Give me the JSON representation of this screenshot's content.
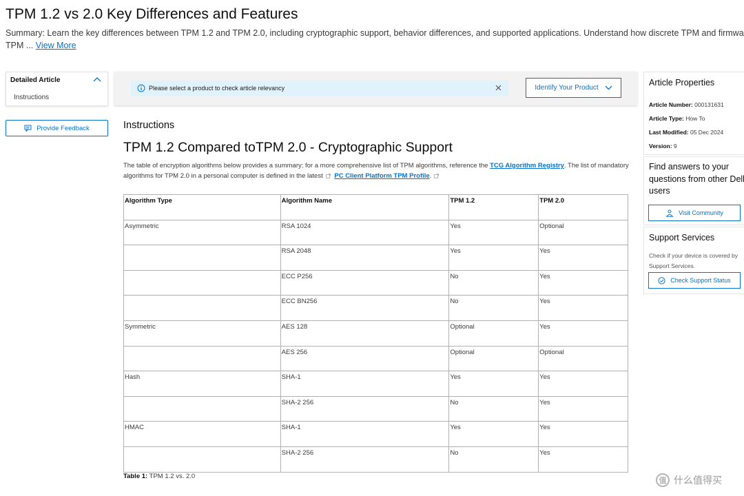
{
  "page": {
    "title": "TPM 1.2 vs 2.0 Key Differences and Features",
    "summary": "Summary: Learn the key differences between TPM 1.2 and TPM 2.0, including cryptographic support, behavior differences, and supported applications. Understand how discrete TPM and firmware TPM ...",
    "view_more": "View More"
  },
  "toc": {
    "heading": "Detailed Article",
    "items": [
      "Instructions"
    ]
  },
  "feedback": {
    "label": "Provide Feedback"
  },
  "product_bar": {
    "notice": "Please select a product to check article relevancy",
    "identify_label": "Identify Your Product"
  },
  "content": {
    "section_heading": "Instructions",
    "heading": "TPM 1.2 Compared toTPM 2.0 - Cryptographic Support",
    "intro_part1": "The table of encryption algorithms below provides a summary; for a more comprehensive list of TPM algorithms, reference the",
    "link1": "TCG Algorithm Registry",
    "intro_part2": ". The list of mandatory algorithms for TPM 2.0 in a personal computer is defined in the latest",
    "link2": "PC Client Platform TPM Profile",
    "intro_part3": ".",
    "table": {
      "headers": [
        "Algorithm Type",
        "Algorithm Name",
        "TPM 1.2",
        "TPM 2.0"
      ],
      "rows": [
        [
          "Asymmetric",
          "RSA 1024",
          "Yes",
          "Optional"
        ],
        [
          "",
          "RSA 2048",
          "Yes",
          "Yes"
        ],
        [
          "",
          "ECC P256",
          "No",
          "Yes"
        ],
        [
          "",
          "ECC BN256",
          "No",
          "Yes"
        ],
        [
          "Symmetric",
          "AES 128",
          "Optional",
          "Yes"
        ],
        [
          "",
          "AES 256",
          "Optional",
          "Optional"
        ],
        [
          "Hash",
          "SHA-1",
          "Yes",
          "Yes"
        ],
        [
          "",
          "SHA-2 256",
          "No",
          "Yes"
        ],
        [
          "HMAC",
          "SHA-1",
          "Yes",
          "Yes"
        ],
        [
          "",
          "SHA-2 256",
          "No",
          "Yes"
        ]
      ]
    },
    "caption_label": "Table 1:",
    "caption_text": "TPM 1.2 vs. 2.0"
  },
  "properties": {
    "heading": "Article Properties",
    "number_label": "Article Number:",
    "number": "000131631",
    "type_label": "Article Type:",
    "type": "How To",
    "modified_label": "Last Modified:",
    "modified": "05 Dec 2024",
    "version_label": "Version:",
    "version": "9"
  },
  "community": {
    "heading": "Find answers to your questions from other Dell users",
    "button": "Visit Community"
  },
  "services": {
    "heading": "Support Services",
    "desc": "Check if your device is covered by Support Services.",
    "button": "Check Support Status"
  },
  "watermark": {
    "text": "什么值得买",
    "glyph": "值"
  },
  "colors": {
    "accent": "#0672cb",
    "banner": "#e0f3fc",
    "bar": "#f2f2f2"
  },
  "icons": [
    "chevron-up-icon",
    "comment-icon",
    "info-icon",
    "close-icon",
    "chevron-down-icon",
    "external-link-icon",
    "community-icon",
    "check-circle-icon"
  ]
}
